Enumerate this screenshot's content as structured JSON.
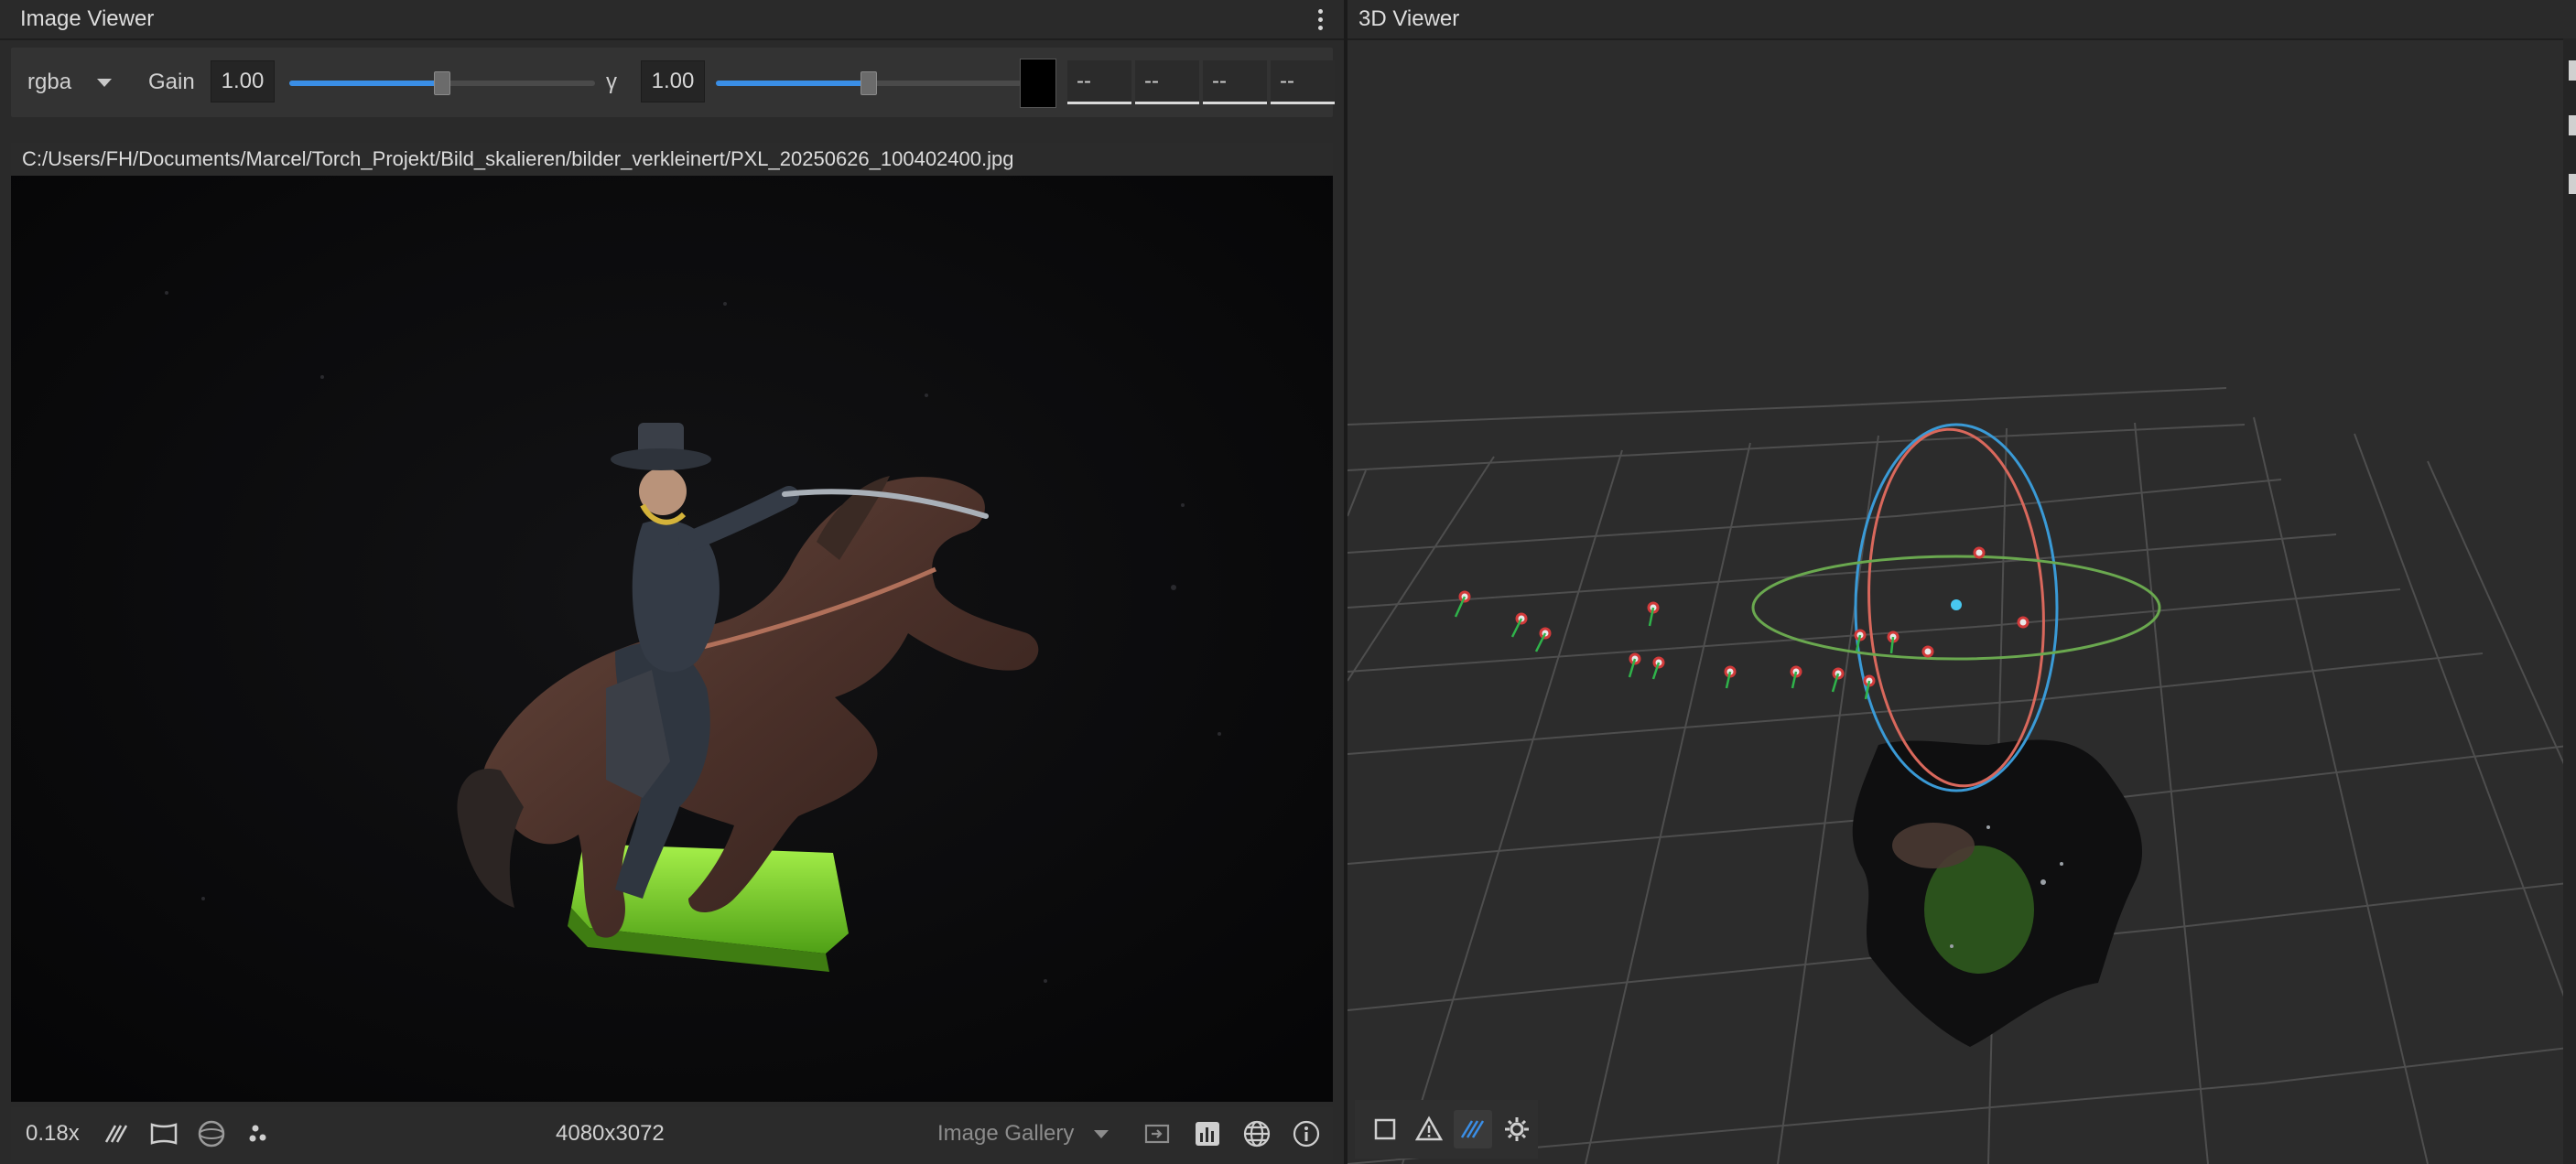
{
  "image_viewer": {
    "title": "Image Viewer",
    "toolbar": {
      "channel_mode": "rgba",
      "gain_label": "Gain",
      "gain_value": "1.00",
      "gain_slider_fraction": 0.5,
      "gamma_label": "γ",
      "gamma_value": "1.00",
      "gamma_slider_fraction": 0.5,
      "pixel_values": [
        "--",
        "--",
        "--",
        "--"
      ]
    },
    "file_path": "C:/Users/FH/Documents/Marcel/Torch_Projekt/Bild_skalieren/bilder_verkleinert/PXL_20250626_100402400.jpg",
    "status": {
      "zoom": "0.18x",
      "resolution": "4080x3072",
      "gallery_select": "Image Gallery"
    },
    "icons": [
      "hatch-icon",
      "frame-icon",
      "sphere-icon",
      "points-icon",
      "export-icon",
      "histogram-icon",
      "globe-icon",
      "info-icon"
    ]
  },
  "viewer_3d": {
    "title": "3D Viewer",
    "bottom_icons": [
      "square-icon",
      "warning-icon",
      "hatch-icon",
      "gear-icon"
    ],
    "active_tool": "hatch-icon"
  },
  "colors": {
    "accent": "#3a8ee6",
    "panel": "#2a2a2a",
    "grid": "#5a5a5a",
    "gizmo_blue": "#3a9ad6",
    "gizmo_red": "#d9685c",
    "gizmo_green": "#6aa84f",
    "base_green": "#7fd63a"
  }
}
